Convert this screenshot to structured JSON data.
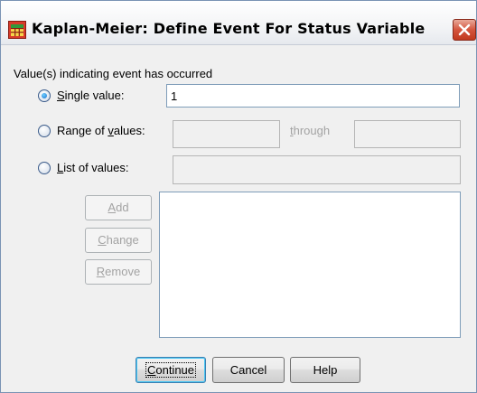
{
  "window": {
    "title": "Kaplan-Meier: Define Event For Status Variable",
    "icon": "spss-table-icon",
    "close_icon": "close-icon"
  },
  "group": {
    "heading": "Value(s) indicating event has occurred"
  },
  "options": {
    "single": {
      "mnemonic": "S",
      "rest": "ingle value:",
      "checked": true,
      "value": "1"
    },
    "range": {
      "before": "Range of ",
      "mnemonic": "v",
      "after": "alues:",
      "checked": false,
      "from_value": "",
      "through_mnemonic": "t",
      "through_rest": "hrough",
      "to_value": ""
    },
    "list": {
      "mnemonic": "L",
      "rest": "ist of values:",
      "checked": false,
      "value": ""
    }
  },
  "list_buttons": {
    "add": {
      "mnemonic": "A",
      "rest": "dd",
      "enabled": false
    },
    "change": {
      "mnemonic": "C",
      "rest": "hange",
      "enabled": false
    },
    "remove": {
      "mnemonic": "R",
      "rest": "emove",
      "enabled": false
    }
  },
  "values_list": [],
  "footer": {
    "continue_mnemonic": "C",
    "continue_rest": "ontinue",
    "cancel": "Cancel",
    "help": "Help"
  },
  "colors": {
    "dialog_bg": "#f0f0f0",
    "close_red": "#c2381e",
    "input_border": "#7f9db9",
    "disabled_text": "#a3a3a3"
  }
}
